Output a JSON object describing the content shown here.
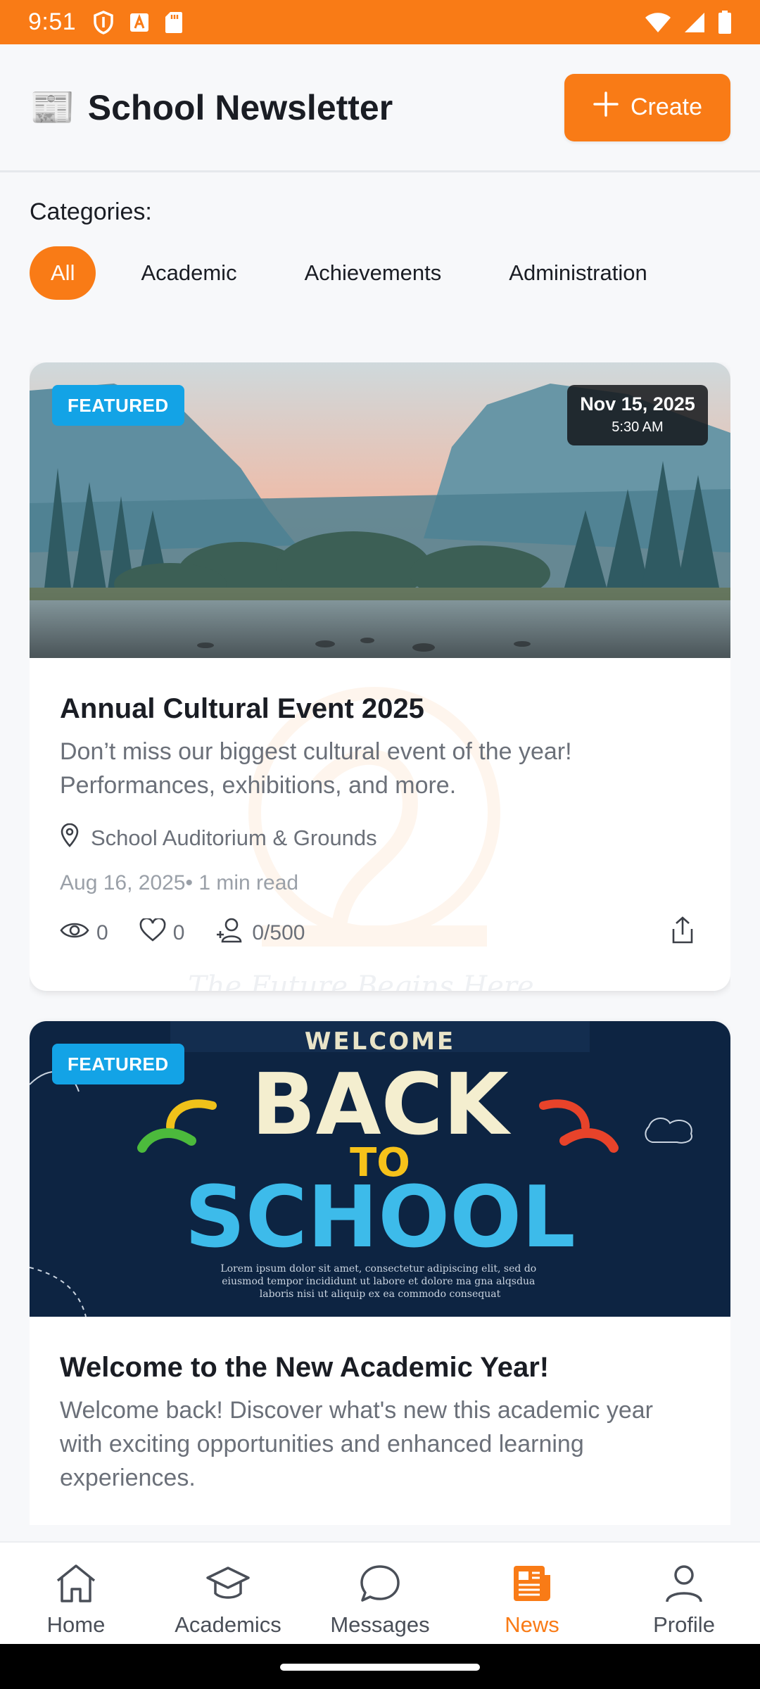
{
  "status_bar": {
    "time": "9:51",
    "left_icons": [
      "shield-icon",
      "font-a-icon",
      "sd-card-icon"
    ],
    "right_icons": [
      "wifi-icon",
      "signal-icon",
      "battery-icon"
    ]
  },
  "header": {
    "icon": "newspaper-icon",
    "icon_glyph": "📰",
    "title": "School Newsletter",
    "create_label": "Create"
  },
  "categories": {
    "label": "Categories:",
    "items": [
      "All",
      "Academic",
      "Achievements",
      "Administration"
    ],
    "selected": "All"
  },
  "posts": [
    {
      "badge": "FEATURED",
      "date": "Nov 15, 2025",
      "time": "5:30 AM",
      "image": "mountain-lake-landscape",
      "title": "Annual Cultural Event 2025",
      "description": "Don’t miss our biggest cultural event of the year! Performances, exhibitions, and more.",
      "location": "School Auditorium & Grounds",
      "meta": "Aug 16, 2025• 1 min read",
      "views": "0",
      "likes": "0",
      "attendees": "0/500"
    },
    {
      "badge": "FEATURED",
      "image": "back-to-school-chalkboard",
      "image_text": {
        "welcome": "WELCOME",
        "line1": "BACK",
        "line2": "TO",
        "line3": "SCHOOL",
        "lorem": "Lorem ipsum dolor sit amet, consectetur adipiscing elit, sed do eiusmod tempor incididunt ut labore et dolore ma gna alqsdua laboris nisi ut aliquip ex ea commodo consequat"
      },
      "title": "Welcome to the New Academic Year!",
      "description": "Welcome back! Discover what's new this academic year with exciting opportunities and enhanced learning experiences."
    }
  ],
  "watermark_text": "The Future Begins Here...",
  "bottom_nav": {
    "items": [
      {
        "label": "Home",
        "icon": "home-icon"
      },
      {
        "label": "Academics",
        "icon": "graduation-cap-icon"
      },
      {
        "label": "Messages",
        "icon": "chat-bubble-icon"
      },
      {
        "label": "News",
        "icon": "newspaper-icon"
      },
      {
        "label": "Profile",
        "icon": "person-icon"
      }
    ],
    "active": "News"
  },
  "colors": {
    "accent": "#f97b16",
    "featured": "#13a3e6",
    "text": "#1a1d24",
    "muted": "#6b7079"
  }
}
